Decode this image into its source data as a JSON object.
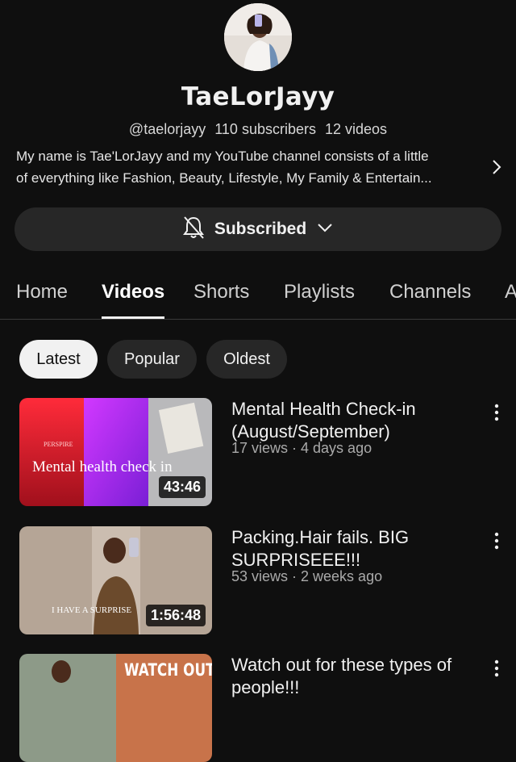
{
  "channel": {
    "name": "TaeLorJayy",
    "handle": "@taelorjayy",
    "subscribers": "110 subscribers",
    "videos_count": "12 videos",
    "description_line1": "My name is Tae'LorJayy and my YouTube channel consists of a little",
    "description_line2": "of everything like Fashion, Beauty, Lifestyle, My Family & Entertain..."
  },
  "subscribe_button": {
    "label": "Subscribed"
  },
  "tabs": [
    {
      "label": "Home"
    },
    {
      "label": "Videos"
    },
    {
      "label": "Shorts"
    },
    {
      "label": "Playlists"
    },
    {
      "label": "Channels"
    },
    {
      "label": "A"
    }
  ],
  "filters": [
    {
      "label": "Latest"
    },
    {
      "label": "Popular"
    },
    {
      "label": "Oldest"
    }
  ],
  "videos": [
    {
      "title": "Mental Health Check-in (August/September)",
      "meta": "17 views · 4 days ago",
      "duration": "43:46",
      "thumb_text": "Mental health check in",
      "thumb_sign": "PERSPIRE"
    },
    {
      "title": "Packing.Hair fails. BIG SURPRISEEE!!!",
      "meta": "53 views · 2 weeks ago",
      "duration": "1:56:48",
      "thumb_text": "I HAVE A SURPRISE"
    },
    {
      "title": "Watch out for these types of people!!!",
      "thumb_text": "WATCH OUT"
    }
  ],
  "colors": {
    "background": "#0f0f0f",
    "surface": "#272727",
    "text_primary": "#f1f1f1",
    "text_secondary": "#aaaaaa"
  }
}
